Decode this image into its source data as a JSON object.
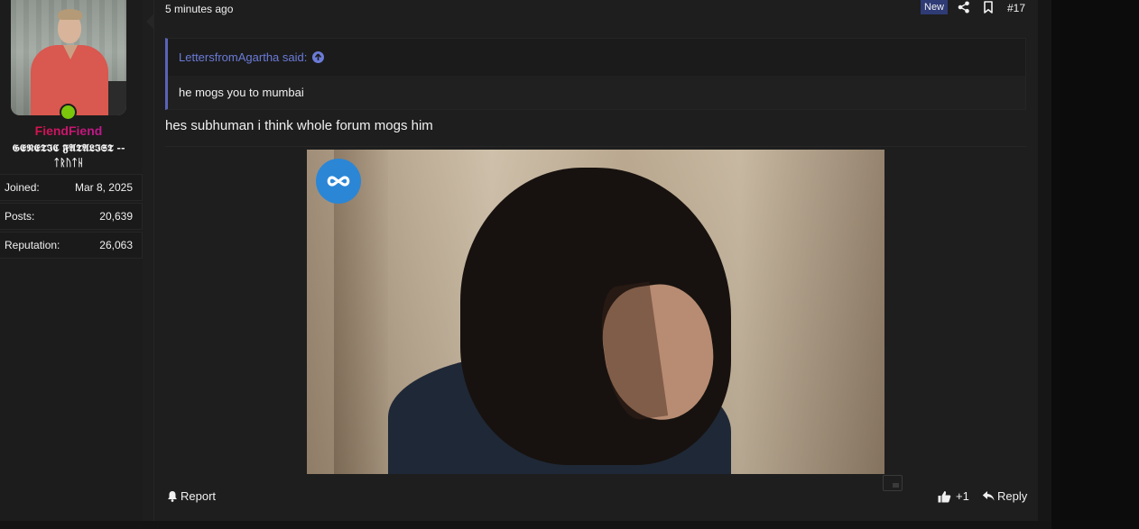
{
  "post": {
    "timestamp": "5 minutes ago",
    "new_badge": "New",
    "post_number": "#17",
    "share_icon": "share-icon",
    "bookmark_icon": "bookmark-icon"
  },
  "user": {
    "username": "FiendFiend",
    "title_line1": "𝕲𝕰𝕹𝕰𝕿𝕴𝕮 𝕱𝕬𝕿𝕬𝕷𝕴𝕾𝕿 --",
    "title_line2": "ᛏᚱᚢᛏᚺ",
    "online": true,
    "stats": [
      {
        "label": "Joined:",
        "value": "Mar 8, 2025"
      },
      {
        "label": "Posts:",
        "value": "20,639"
      },
      {
        "label": "Reputation:",
        "value": "26,063"
      }
    ]
  },
  "quote": {
    "author_said": "LettersfromAgartha said:",
    "body": "he mogs you to mumbai"
  },
  "message": {
    "text": "hes subhuman i think whole forum mogs him"
  },
  "footer": {
    "report_label": "Report",
    "like_count": "+1",
    "reply_label": "Reply"
  },
  "colors": {
    "accent": "#5a63b8",
    "quote_link": "#6b7bd8",
    "new_badge_bg": "#2e3b75",
    "online": "#7ac70c",
    "username_gradient_start": "#e0102a",
    "username_gradient_end": "#b21bb3"
  }
}
